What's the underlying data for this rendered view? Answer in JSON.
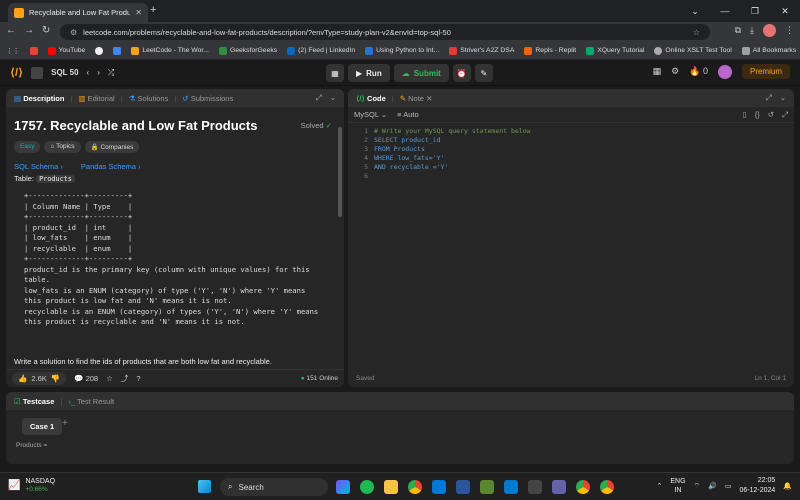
{
  "browser": {
    "tab_title": "Recyclable and Low Fat Products",
    "url": "leetcode.com/problems/recyclable-and-low-fat-products/description/?envType=study-plan-v2&envId=top-sql-50",
    "bookmarks": [
      "YouTube",
      "LeetCode - The Wor...",
      "GeeksforGeeks",
      "(2) Feed | LinkedIn",
      "Using Python to Int...",
      "Striver's A2Z DSA",
      "Repls - Replit",
      "XQuery Tutorial",
      "Online XSLT Test Tool"
    ],
    "all_bookmarks": "All Bookmarks"
  },
  "header": {
    "list_name": "SQL 50",
    "run_label": "Run",
    "submit_label": "Submit",
    "streak": "0",
    "premium_label": "Premium"
  },
  "description": {
    "tabs": [
      "Description",
      "Editorial",
      "Solutions",
      "Submissions"
    ],
    "title": "1757. Recyclable and Low Fat Products",
    "status": "Solved",
    "tags": [
      "Easy",
      "Topics",
      "Companies"
    ],
    "links": [
      "SQL Schema",
      "Pandas Schema"
    ],
    "table_label": "Table:",
    "table_name": "Products",
    "schema": "+-------------+---------+\n| Column Name | Type    |\n+-------------+---------+\n| product_id  | int     |\n| low_fats    | enum    |\n| recyclable  | enum    |\n+-------------+---------+",
    "lines": [
      "product_id is the primary key (column with unique values) for this",
      "table.",
      "low_fats is an ENUM (category) of type ('Y', 'N') where 'Y' means",
      "this product is low fat and 'N' means it is not.",
      "recyclable is an ENUM (category) of types ('Y', 'N') where 'Y' means",
      "this product is recyclable and 'N' means it is not."
    ],
    "task": "Write a solution to find the ids of products that are both low fat and recyclable.",
    "likes": "2.6K",
    "comments": "208",
    "online": "151 Online"
  },
  "code": {
    "tabs": [
      "Code",
      "Note"
    ],
    "language": "MySQL",
    "mode": "Auto",
    "lines": [
      "# Write your MySQL query statement below",
      "SELECT product_id",
      "FROM Products",
      "WHERE low_fats='Y'",
      "AND recyclable ='Y'",
      ""
    ],
    "status": "Saved",
    "cursor": "Ln 1, Col 1"
  },
  "testcase": {
    "tabs": [
      "Testcase",
      "Test Result"
    ],
    "case_label": "Case 1",
    "products_label": "Products ="
  },
  "taskbar": {
    "stock_name": "NASDAQ",
    "stock_change": "+0.66%",
    "search_placeholder": "Search",
    "lang1": "ENG",
    "lang2": "IN",
    "time": "22:05",
    "date": "06-12-2024"
  }
}
